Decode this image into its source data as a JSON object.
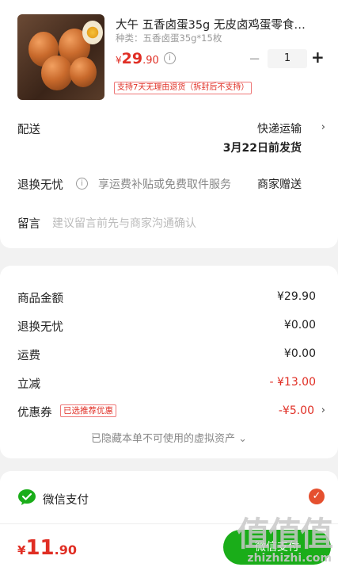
{
  "product": {
    "title": "大午 五香卤蛋35g 无皮卤鸡蛋零食…",
    "variant": "种类：五香卤蛋35g*15枚",
    "price_symbol": "¥",
    "price_int": "29",
    "price_dec": ".90",
    "quantity": "1",
    "return_badge": "支持7天无理由退货（拆封后不支持）"
  },
  "delivery": {
    "label": "配送",
    "method": "快递运输",
    "date": "3月22日前发货"
  },
  "returns": {
    "label": "退换无忧",
    "text": "享运费补贴或免费取件服务",
    "right": "商家赠送"
  },
  "message": {
    "label": "留言",
    "placeholder": "建议留言前先与商家沟通确认"
  },
  "summary": {
    "rows": [
      {
        "label": "商品金额",
        "value": "¥29.90"
      },
      {
        "label": "退换无忧",
        "value": "¥0.00"
      },
      {
        "label": "运费",
        "value": "¥0.00"
      },
      {
        "label": "立减",
        "value": "- ¥13.00"
      },
      {
        "label": "优惠券",
        "value": "-¥5.00"
      }
    ],
    "coupon_badge": "已选推荐优惠",
    "hidden_assets": "已隐藏本单不可使用的虚拟资产 ⌄"
  },
  "payment": {
    "method": "微信支付",
    "total_symbol": "¥",
    "total_int": "11",
    "total_dec": ".90",
    "button": "微信支付"
  },
  "watermark": {
    "text": "值值值",
    "url": "zhizhizhi.com"
  },
  "colors": {
    "accent_red": "#e02e24",
    "wechat_green": "#1aad19"
  }
}
